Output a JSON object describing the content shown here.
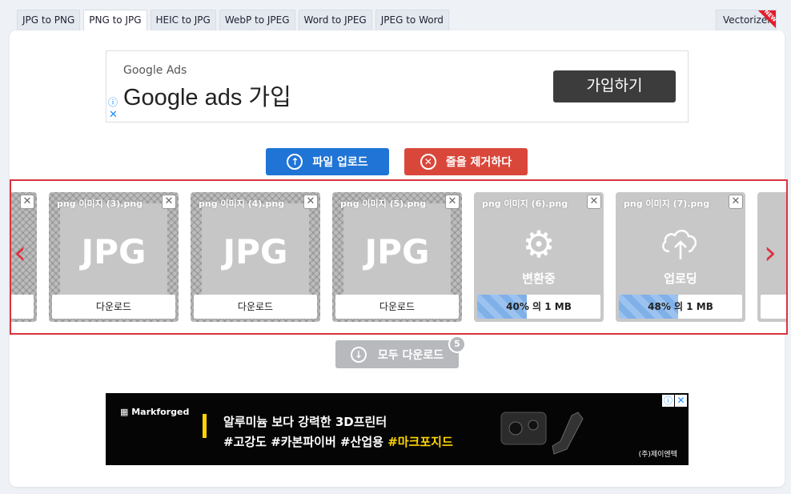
{
  "tabs": [
    {
      "label": "JPG to PNG"
    },
    {
      "label": "PNG to JPG",
      "active": true
    },
    {
      "label": "HEIC to JPG"
    },
    {
      "label": "WebP to JPEG"
    },
    {
      "label": "Word to JPEG"
    },
    {
      "label": "JPEG to Word"
    }
  ],
  "tab_right": {
    "label": "Vectorizer",
    "ribbon": "NEW"
  },
  "ad1": {
    "brand": "Google Ads",
    "title": "Google ads 가입",
    "cta": "가입하기",
    "info_icon": "ⓘ",
    "close_icon": "✕"
  },
  "actions": {
    "upload_label": "파일 업로드",
    "clear_label": "줄을 제거하다"
  },
  "carousel": {
    "prev_icon": "‹",
    "next_icon": "›",
    "cards": [
      {
        "filename": "png 이미지 (3).png",
        "result": "JPG",
        "action": "다운로드"
      },
      {
        "filename": "png 이미지 (4).png",
        "result": "JPG",
        "action": "다운로드"
      },
      {
        "filename": "png 이미지 (5).png",
        "result": "JPG",
        "action": "다운로드"
      },
      {
        "filename": "png 이미지 (6).png",
        "status": "변환중",
        "progress_text": "40% 의 1 MB",
        "progress": 0.4
      },
      {
        "filename": "png 이미지 (7).png",
        "status": "업로딩",
        "progress_text": "48% 의 1 MB",
        "progress": 0.48
      }
    ]
  },
  "download_all": {
    "label": "모두 다운로드",
    "count": "5"
  },
  "ad2": {
    "brand": "Markforged",
    "line1": "알루미늄 보다 강력한 3D프린터",
    "line2_prefix": "#고강도 #카본파이버 #산업용 ",
    "line2_highlight": "#마크포지드",
    "company": "(주)제이엔텍"
  },
  "colors": {
    "upload": "#1f74d6",
    "clear": "#d9473a",
    "carousel_border": "#d9343f",
    "highlight": "#ffd400"
  }
}
